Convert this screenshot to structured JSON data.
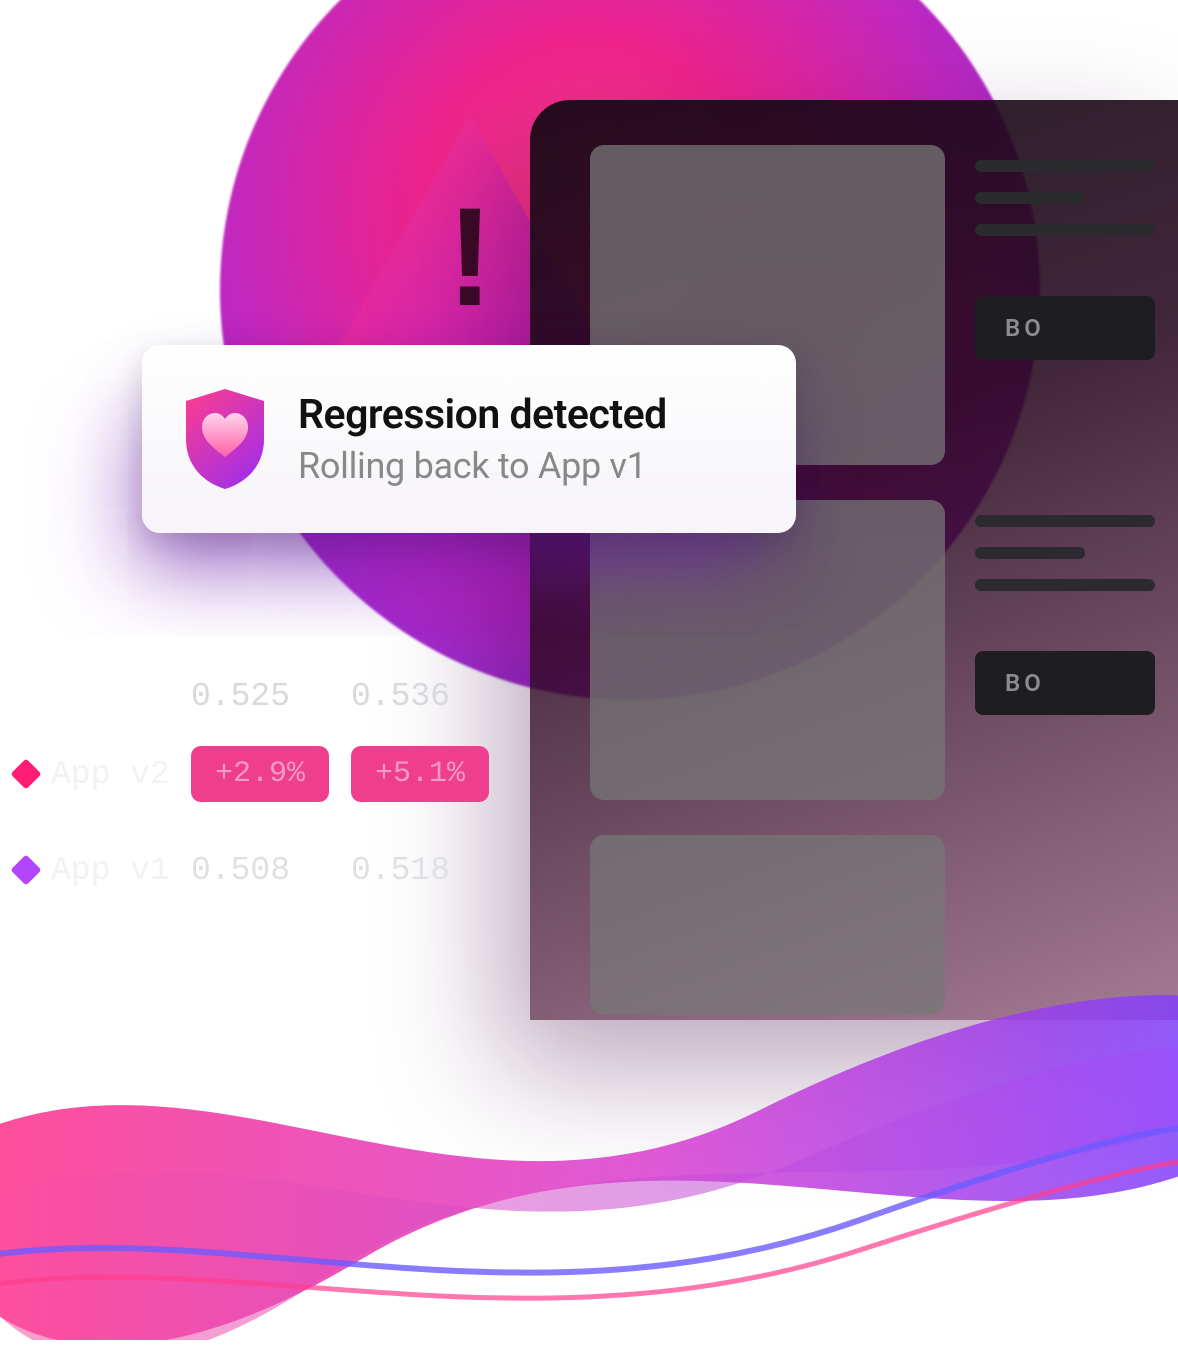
{
  "alert": {
    "icon": "shield-heart-icon",
    "title": "Regression detected",
    "subtitle": "Rolling back to App v1"
  },
  "warning": {
    "glyph": "!"
  },
  "phone": {
    "button_label": "BO"
  },
  "metrics": {
    "headers": {
      "c1": "0.525",
      "c2": "0.536"
    },
    "rows": [
      {
        "marker": "pink",
        "label": "App v2",
        "c1": "+2.9%",
        "c2": "+5.1%",
        "style": "pill"
      },
      {
        "marker": "purple",
        "label": "App v1",
        "c1": "0.508",
        "c2": "0.518",
        "style": "plain"
      }
    ]
  }
}
